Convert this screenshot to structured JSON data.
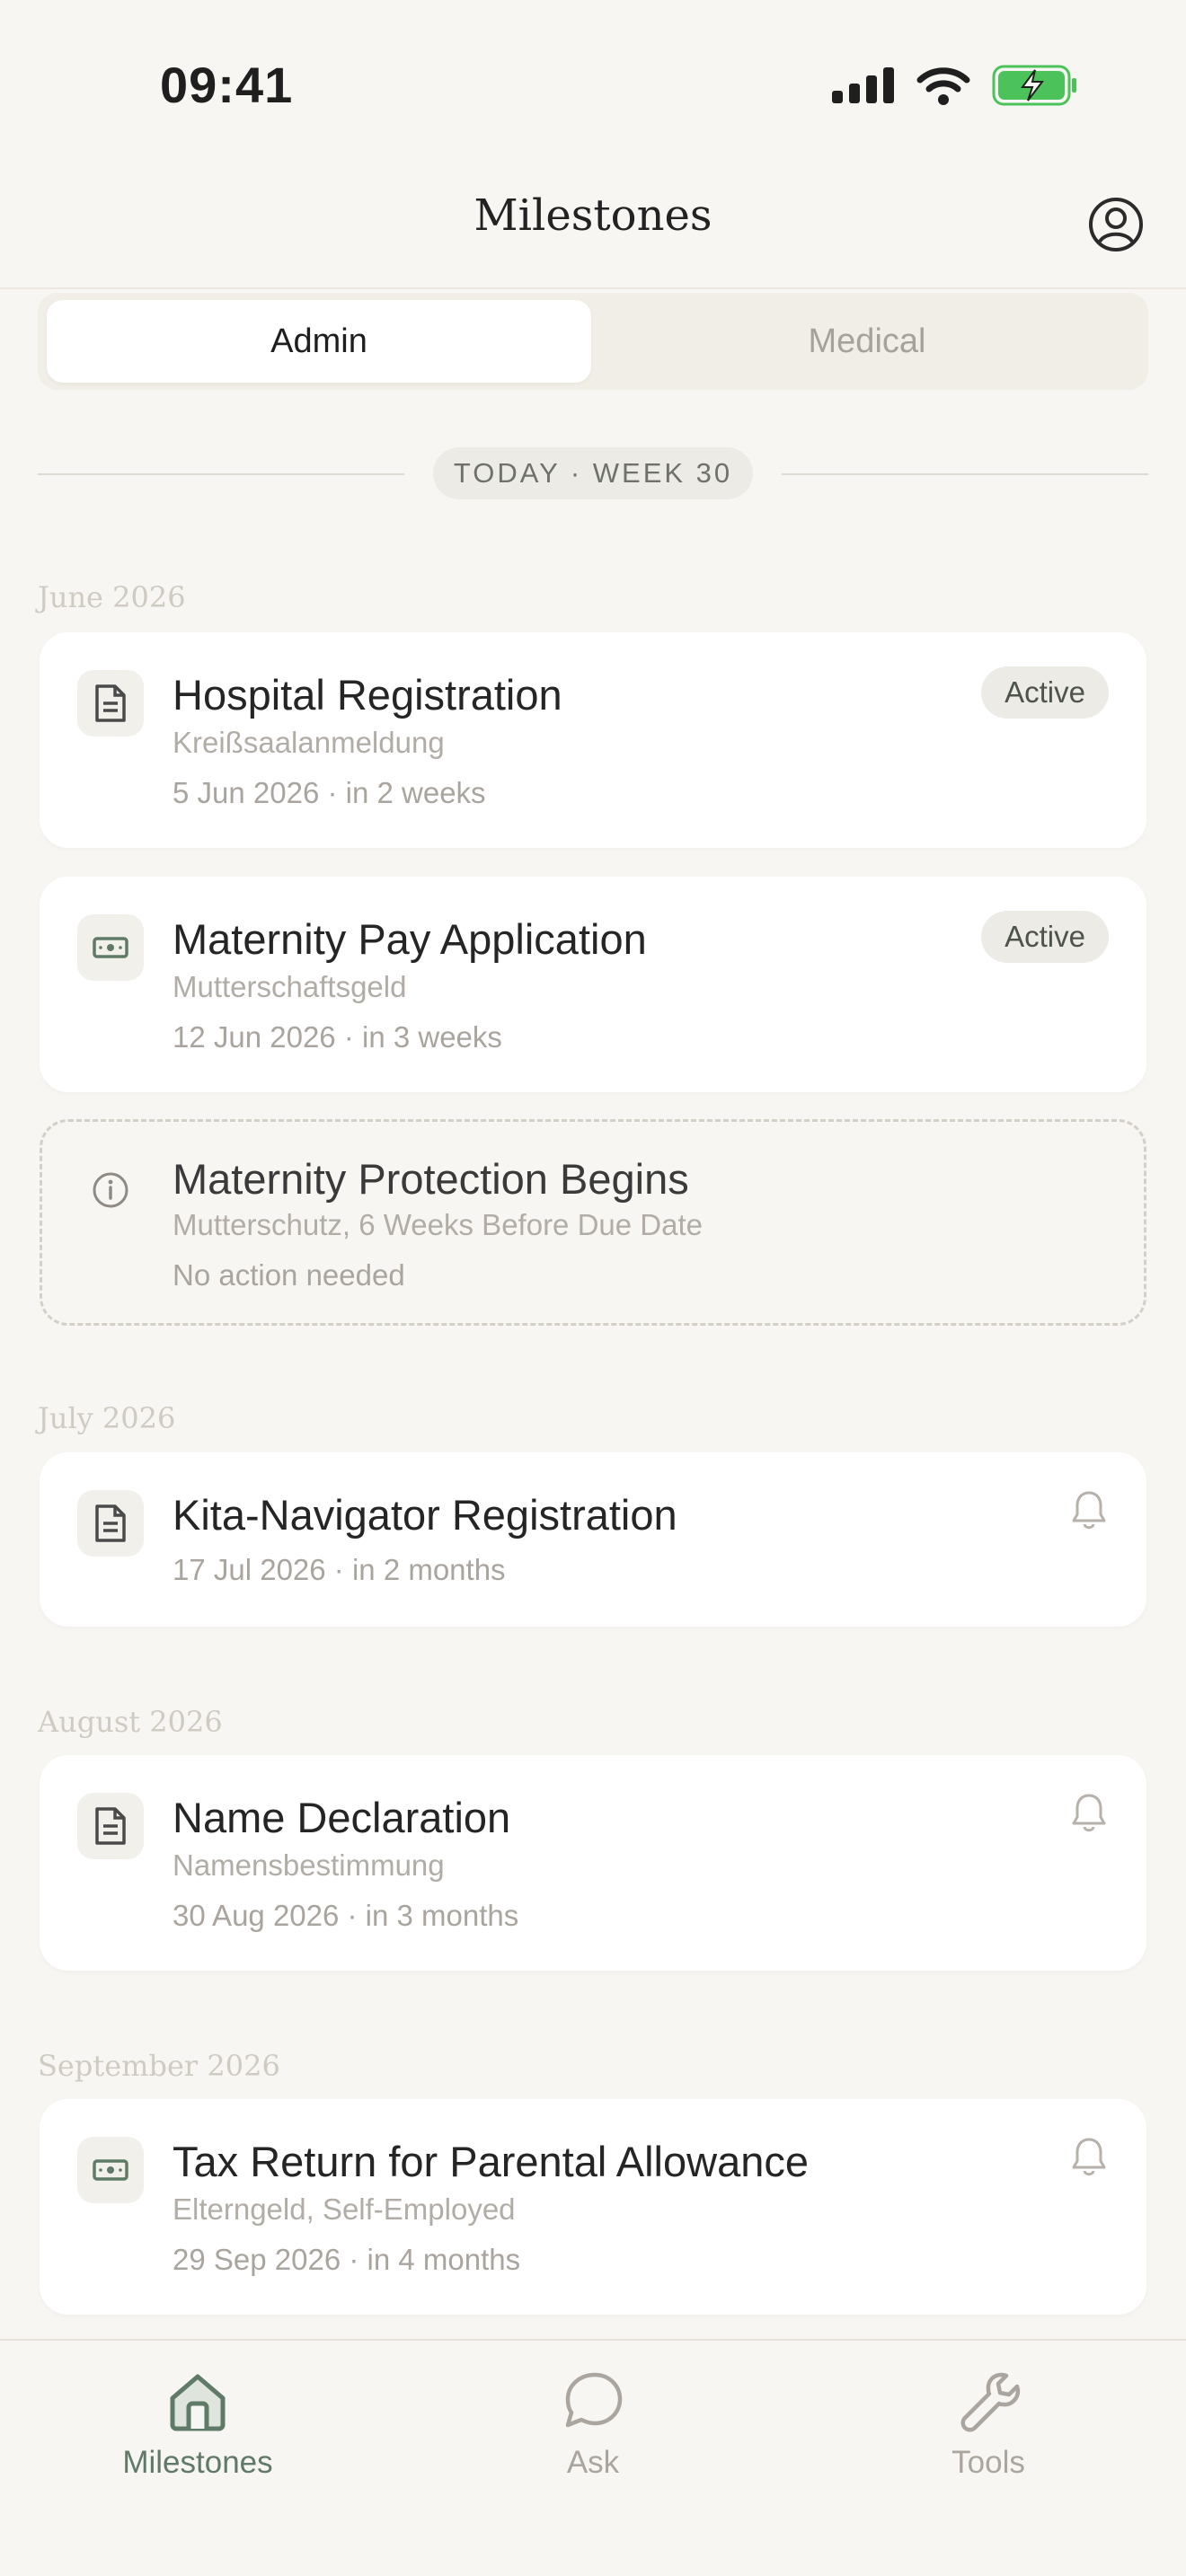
{
  "status_bar": {
    "time": "09:41"
  },
  "header": {
    "title": "Milestones"
  },
  "segments": {
    "admin": "Admin",
    "medical": "Medical",
    "selected": "Admin"
  },
  "today": {
    "label": "TODAY · WEEK 30"
  },
  "months": [
    "June 2026",
    "July 2026",
    "August 2026",
    "September 2026"
  ],
  "cards": [
    {
      "title": "Hospital Registration",
      "subtitle": "Kreißsaalanmeldung",
      "meta": "5 Jun 2026 · in 2 weeks",
      "badge": "Active",
      "icon": "document-icon"
    },
    {
      "title": "Maternity Pay Application",
      "subtitle": "Mutterschaftsgeld",
      "meta": "12 Jun 2026 · in 3 weeks",
      "badge": "Active",
      "icon": "money-icon"
    },
    {
      "title": "Maternity Protection Begins",
      "subtitle": "Mutterschutz, 6 Weeks Before Due Date",
      "meta": "No action needed",
      "icon": "info-icon"
    },
    {
      "title": "Kita-Navigator Registration",
      "meta": "17 Jul 2026 · in 2 months",
      "icon": "document-icon"
    },
    {
      "title": "Name Declaration",
      "subtitle": "Namensbestimmung",
      "meta": "30 Aug 2026 · in 3 months",
      "icon": "document-icon"
    },
    {
      "title": "Tax Return for Parental Allowance",
      "subtitle": "Elterngeld, Self-Employed",
      "meta": "29 Sep 2026 · in 4 months",
      "icon": "money-icon"
    }
  ],
  "tabbar": {
    "milestones": "Milestones",
    "ask": "Ask",
    "tools": "Tools",
    "active": "Milestones"
  },
  "colors": {
    "accent": "#5f7a66",
    "background": "#f8f6f2",
    "battery": "#4cc35a"
  }
}
